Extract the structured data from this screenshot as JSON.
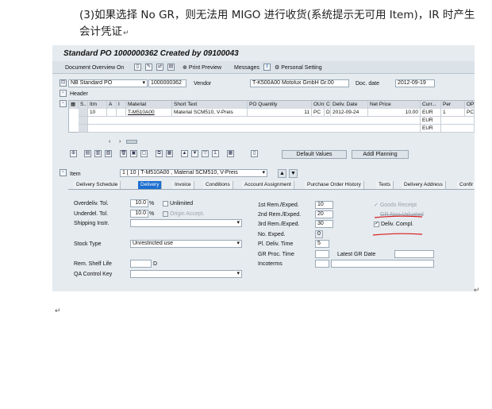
{
  "doc": {
    "line1": "(3)如果选择 No GR，则无法用 MIGO 进行收货(系统提示无可用 Item)，IR 时产生",
    "line2": "会计凭证",
    "return_mark": "↵"
  },
  "sap": {
    "title": "Standard PO 1000000362 Created by 09100043",
    "toolbar": {
      "doc_overview": "Document Overview On",
      "print_preview": "Print Preview",
      "messages": "Messages",
      "personal_setting": "Personal Setting"
    },
    "header": {
      "po_type": "NB Standard PO",
      "po_number": "1000000362",
      "vendor_label": "Vendor",
      "vendor_value": "T-K500A00 Motolux GmbH Gr.00",
      "doc_date_label": "Doc. date",
      "doc_date": "2012-09-19",
      "header_label": "Header"
    },
    "grid": {
      "columns": [
        "S..",
        "Itm",
        "A",
        "I",
        "Material",
        "Short Text",
        "PO Quantity",
        "OUn",
        "C",
        "Deliv. Date",
        "Net Price",
        "Curr...",
        "Per",
        "OP"
      ],
      "rows": [
        {
          "itm": "10",
          "material": "T-M510A00",
          "short_text": "Material SCM510, V-Preis",
          "qty": "11",
          "oun": "PC",
          "c": "D",
          "deliv_date": "2012-09-24",
          "net_price": "10.00",
          "curr": "EUR",
          "per": "1",
          "op": "PC"
        },
        {
          "itm": "",
          "material": "",
          "short_text": "",
          "qty": "",
          "oun": "",
          "c": "",
          "deliv_date": "",
          "net_price": "",
          "curr": "EUR",
          "per": "",
          "op": ""
        },
        {
          "itm": "",
          "material": "",
          "short_text": "",
          "qty": "",
          "oun": "",
          "c": "",
          "deliv_date": "",
          "net_price": "",
          "curr": "EUR",
          "per": "",
          "op": ""
        }
      ],
      "default_values_btn": "Default Values",
      "addl_planning_btn": "Addl Planning"
    },
    "item": {
      "label": "Item",
      "selector": "1 [ 10 ] T-M510A00 , Material SCM510, V-Preis"
    },
    "tabs": [
      "Delivery Schedule",
      "Delivery",
      "Invoice",
      "Conditions",
      "Account Assignment",
      "Purchase Order History",
      "Texts",
      "Delivery Address",
      "Confir"
    ],
    "active_tab": "Delivery",
    "delivery": {
      "overdel_label": "Overdeliv. Tol.",
      "overdel_value": "10.0",
      "underdel_label": "Underdel. Tol.",
      "underdel_value": "10.0",
      "percent": "%",
      "unlimited": "Unlimited",
      "origin_accept": "Origin Accept.",
      "shipping_label": "Shipping Instr.",
      "stock_type_label": "Stock Type",
      "stock_type_value": "Unrestricted use",
      "rem_shelf_label": "Rem. Shelf Life",
      "rem_shelf_unit": "D",
      "qa_label": "QA Control Key",
      "rem1_label": "1st Rem./Exped.",
      "rem1_value": "10",
      "rem2_label": "2nd Rem./Exped.",
      "rem2_value": "20",
      "rem3_label": "3rd Rem./Exped.",
      "rem3_value": "30",
      "no_exped_label": "No. Exped.",
      "no_exped_value": "0",
      "pl_deliv_label": "Pl. Deliv. Time",
      "pl_deliv_value": "5",
      "gr_proc_label": "GR Proc. Time",
      "incoterms_label": "Incoterms",
      "latest_gr_label": "Latest GR Date",
      "goods_receipt": "Goods Receipt",
      "gr_non_valuated": "GR Non-Valuated",
      "deliv_compl": "Deliv. Compl."
    },
    "colors": {
      "active_tab": "#1d6fcf",
      "annotation": "#d81c1c"
    }
  }
}
